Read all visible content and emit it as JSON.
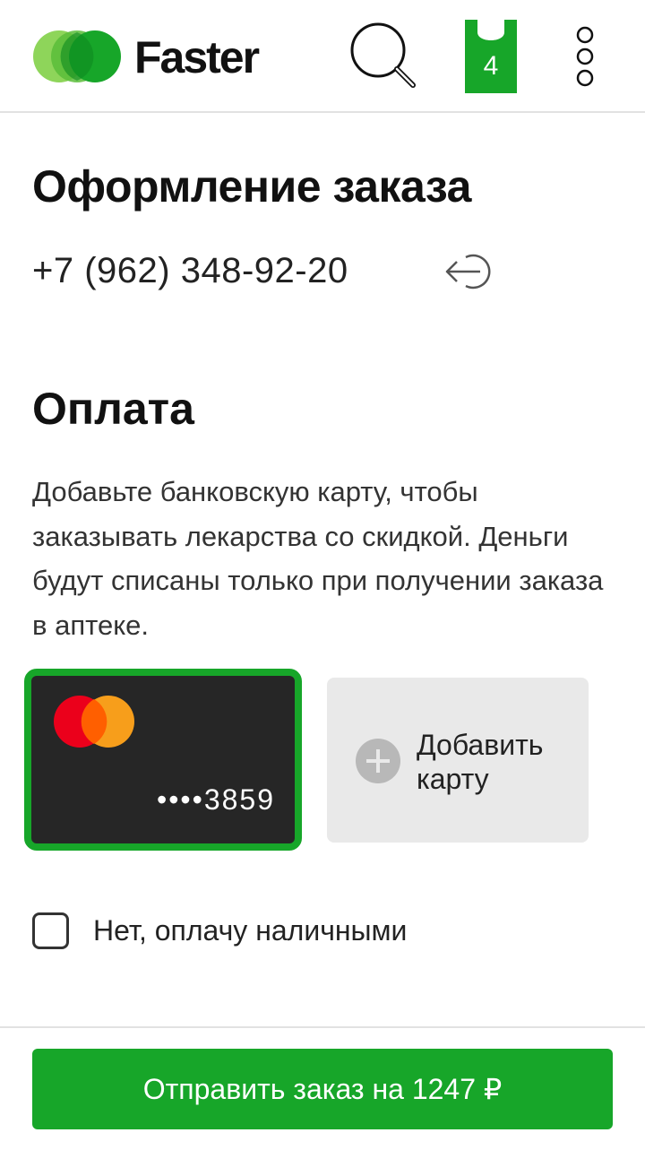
{
  "header": {
    "brand": "Faster",
    "cart_count": "4",
    "icons": {
      "logo": "faster-logo-icon",
      "search": "search-icon",
      "cart": "shopping-bag-icon",
      "menu": "more-vertical-icon"
    }
  },
  "checkout": {
    "title": "Оформление заказа",
    "phone": "+7 (962) 348-92-20",
    "logout_icon": "logout-icon"
  },
  "payment": {
    "title": "Оплата",
    "description": "Добавьте банковскую карту, чтобы заказывать лекарства со скидкой. Деньги будут списаны только при получении заказа в аптеке.",
    "saved_card": {
      "number_masked": "••••3859",
      "brand_icon": "mastercard-icon"
    },
    "add_card": {
      "label": "Добавить карту",
      "icon": "plus-circle-icon"
    },
    "cash_option": {
      "label": "Нет, оплачу наличными",
      "checked": false
    }
  },
  "submit": {
    "label": "Отправить заказ на 1247 ₽"
  },
  "colors": {
    "accent_green": "#17a629",
    "logo_light_green": "#8ed55a",
    "card_dark": "#262626",
    "add_card_bg": "#e9e9e9",
    "mastercard_red": "#eb001b",
    "mastercard_orange": "#f79e1b"
  }
}
